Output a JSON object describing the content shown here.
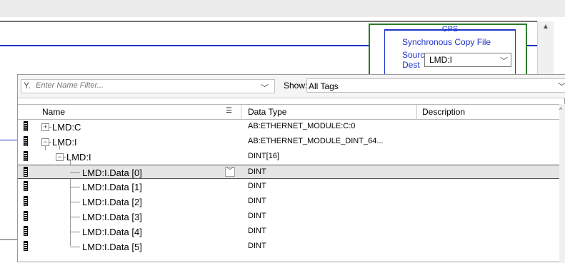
{
  "instruction": {
    "title": "CPS",
    "description": "Synchronous Copy File",
    "source_label": "Source",
    "source_value": "LMD:I",
    "dest_label": "Dest"
  },
  "filter": {
    "placeholder": "Enter Name Filter...",
    "show_label": "Show:",
    "show_value": "All Tags"
  },
  "columns": {
    "name": "Name",
    "data_type": "Data Type",
    "description": "Description"
  },
  "rows": [
    {
      "name": "LMD:C",
      "type": "AB:ETHERNET_MODULE:C:0",
      "expander": "+"
    },
    {
      "name": "LMD:I",
      "type": "AB:ETHERNET_MODULE_DINT_64...",
      "expander": "−"
    },
    {
      "name": "LMD:I",
      "type": "DINT[16]",
      "expander": "−"
    },
    {
      "name": "LMD:I.Data [0]",
      "type": "DINT",
      "selected": true
    },
    {
      "name": "LMD:I.Data [1]",
      "type": "DINT"
    },
    {
      "name": "LMD:I.Data [2]",
      "type": "DINT"
    },
    {
      "name": "LMD:I.Data [3]",
      "type": "DINT"
    },
    {
      "name": "LMD:I.Data [4]",
      "type": "DINT"
    },
    {
      "name": "LMD:I.Data [5]",
      "type": "DINT"
    }
  ],
  "colors": {
    "rung": "#1f34c8",
    "instruction_frame": "#2a7d2a",
    "selected_row": "#e5e5e5"
  },
  "icons": {
    "filter": "funnel-icon",
    "dropdown": "chevron-down-icon",
    "tag": "tag-icon",
    "sort": "sort-icon"
  }
}
